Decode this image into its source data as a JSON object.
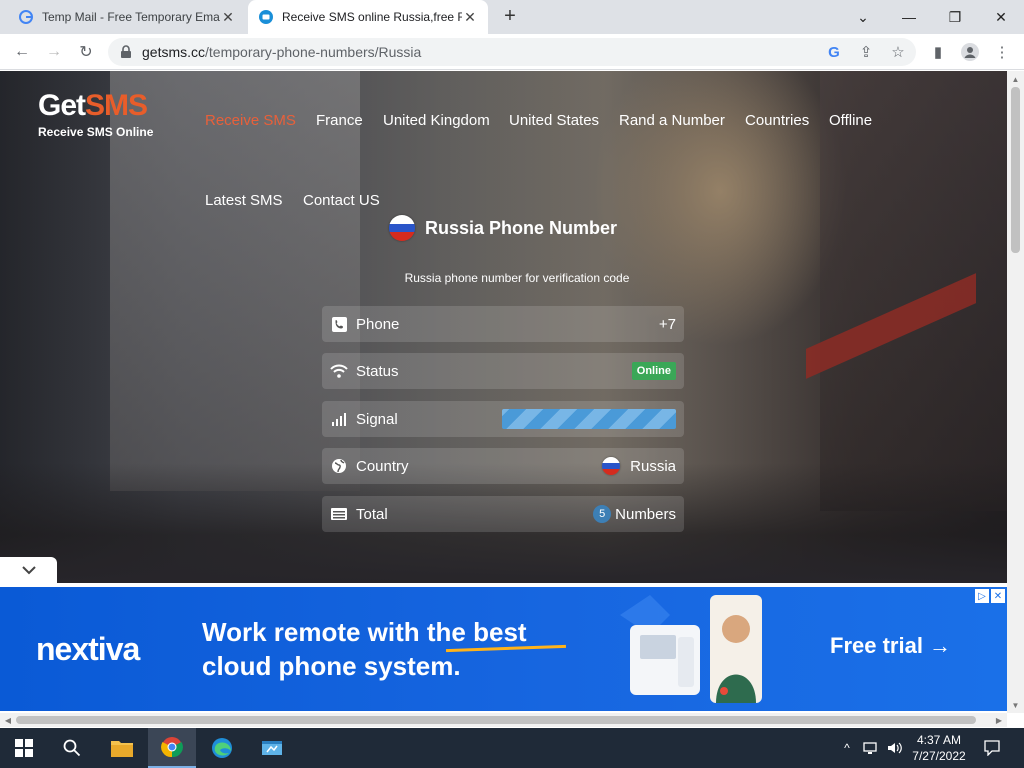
{
  "browser": {
    "tabs": [
      {
        "title": "Temp Mail - Free Temporary Ema",
        "active": false
      },
      {
        "title": "Receive SMS online Russia,free R",
        "active": true
      }
    ],
    "url_host": "getsms.cc",
    "url_path": "/temporary-phone-numbers/Russia"
  },
  "site": {
    "logo_prefix": "Get",
    "logo_suffix": "SMS",
    "tagline": "Receive SMS Online",
    "nav": [
      "Receive SMS",
      "France",
      "United Kingdom",
      "United States",
      "Rand a Number",
      "Countries",
      "Offline",
      "Latest SMS",
      "Contact US"
    ],
    "heading": "Russia Phone Number",
    "subtitle": "Russia phone number for verification code"
  },
  "info_rows": {
    "phone": {
      "label": "Phone",
      "value": "+7"
    },
    "status": {
      "label": "Status",
      "value": "Online"
    },
    "signal": {
      "label": "Signal",
      "level": 1.0
    },
    "country": {
      "label": "Country",
      "value": "Russia"
    },
    "total": {
      "label": "Total",
      "count": "5",
      "unit": "Numbers"
    }
  },
  "ad": {
    "brand": "nextiva",
    "headline_line1": "Work remote with the best",
    "headline_line2": "cloud phone system.",
    "cta": "Free trial →"
  },
  "taskbar": {
    "time": "4:37 AM",
    "date": "7/27/2022"
  },
  "colors": {
    "accent": "#e85d2a",
    "online": "#3aa757",
    "ad_bg": "#1766e0"
  }
}
